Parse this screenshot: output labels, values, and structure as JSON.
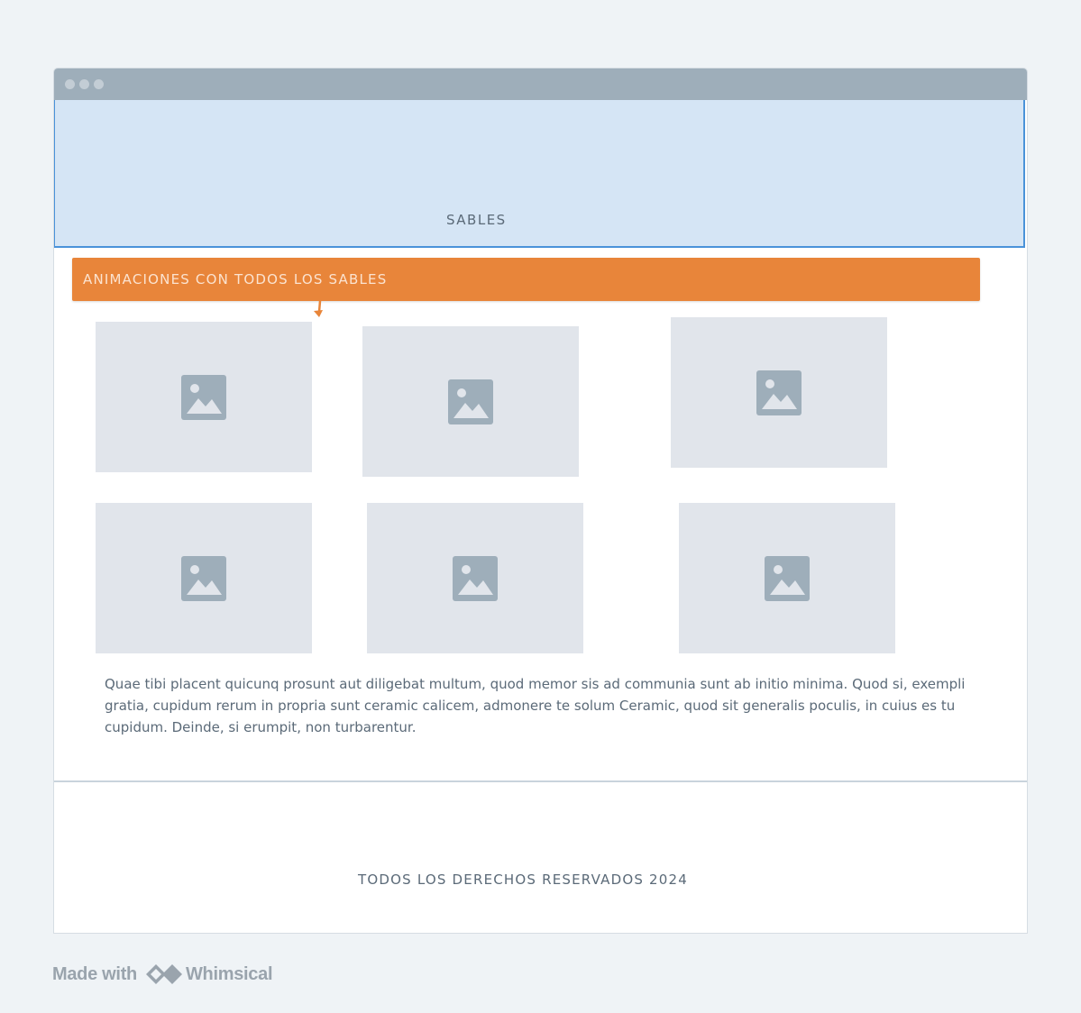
{
  "hero": {
    "title": "SABLES"
  },
  "banner": {
    "label": "ANIMACIONES CON TODOS LOS SABLES"
  },
  "gallery": {
    "items": [
      {
        "icon": "image-placeholder-icon"
      },
      {
        "icon": "image-placeholder-icon"
      },
      {
        "icon": "image-placeholder-icon"
      },
      {
        "icon": "image-placeholder-icon"
      },
      {
        "icon": "image-placeholder-icon"
      },
      {
        "icon": "image-placeholder-icon"
      }
    ]
  },
  "content": {
    "paragraph": "Quae tibi placent quicunq prosunt aut diligebat multum, quod memor sis ad communia sunt ab initio minima. Quod si, exempli gratia, cupidum rerum in propria sunt ceramic calicem, admonere te solum Ceramic, quod sit generalis poculis, in cuius es tu cupidum. Deinde, si erumpit, non turbarentur."
  },
  "footer": {
    "text": "TODOS LOS DERECHOS RESERVADOS 2024"
  },
  "branding": {
    "made_with": "Made with",
    "brand": "Whimsical"
  },
  "colors": {
    "accent": "#e8853a",
    "hero_bg": "#d5e5f5",
    "hero_border": "#4a92d9",
    "placeholder_bg": "#e1e5eb",
    "placeholder_icon": "#9eaeba"
  }
}
